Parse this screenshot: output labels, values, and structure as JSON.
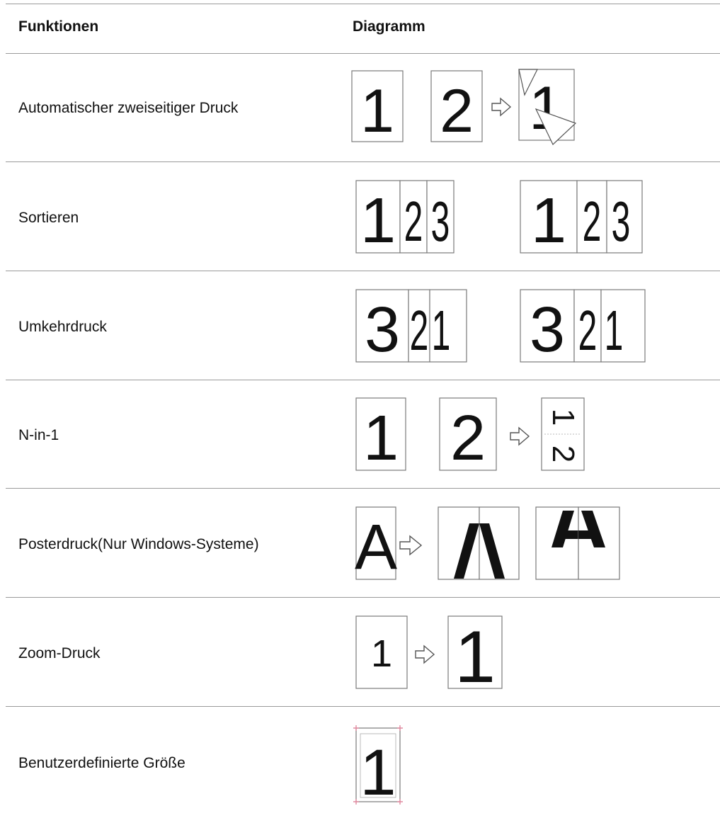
{
  "header": {
    "col_functions": "Funktionen",
    "col_diagram": "Diagramm"
  },
  "rows": [
    {
      "label": "Automatischer zweiseitiger Druck"
    },
    {
      "label": "Sortieren"
    },
    {
      "label": "Umkehrdruck"
    },
    {
      "label": "N-in-1"
    },
    {
      "label": "Posterdruck(Nur Windows-Systeme)"
    },
    {
      "label": "Zoom-Druck"
    },
    {
      "label": "Benutzerdefinierte Größe"
    }
  ],
  "diagram_text": {
    "duplex": [
      "1",
      "2",
      "1"
    ],
    "collate": [
      "1",
      "2",
      "3",
      "1",
      "2",
      "3"
    ],
    "reverse": [
      "3",
      "2",
      "1",
      "3",
      "2",
      "1"
    ],
    "nup": [
      "1",
      "2",
      "1",
      "2"
    ],
    "poster": [
      "A"
    ],
    "zoom": [
      "1",
      "1"
    ],
    "custom": [
      "1"
    ]
  },
  "icons": {
    "arrow": "outline-right-arrow-icon"
  }
}
